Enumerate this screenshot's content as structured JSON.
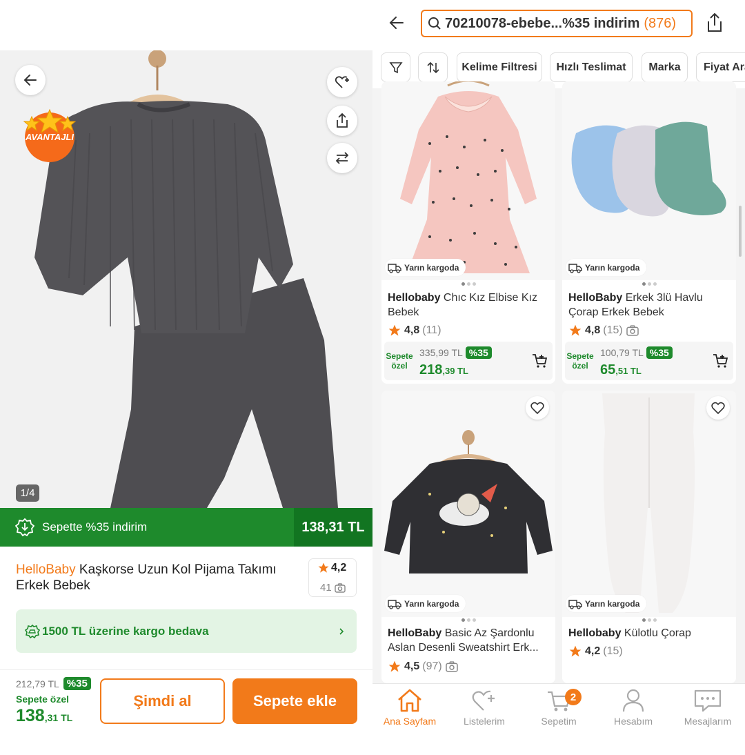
{
  "left": {
    "avantaj_label": "AVANTAJLI",
    "image_counter": "1/4",
    "promo": {
      "text": "Sepette %35 indirim",
      "price": "138,31 TL"
    },
    "product": {
      "brand": "HelloBaby",
      "name": "Kaşkorse Uzun Kol Pijama Takımı Erkek Bebek",
      "rating": "4,2",
      "review_count": "41"
    },
    "shipping_banner": "1500 TL üzerine kargo bedava",
    "bottom": {
      "old_price": "212,79 TL",
      "discount": "%35",
      "basket_label": "Sepete özel",
      "price_main": "138",
      "price_cents": ",31 TL",
      "buy_now": "Şimdi al",
      "add_to_cart": "Sepete ekle"
    }
  },
  "right": {
    "search": {
      "query": "70210078-ebebe...%35 indirim",
      "count": "(876)"
    },
    "filters": [
      "Kelime Filtresi",
      "Hızlı Teslimat",
      "Marka",
      "Fiyat Ara"
    ],
    "cards": [
      {
        "brand": "Hellobaby",
        "title": "Chıc Kız Elbise Kız Bebek",
        "rating": "4,8",
        "count": "(11)",
        "cargo": "Yarın kargoda",
        "basket_label": "Sepete özel",
        "old_price": "335,99 TL",
        "discount": "%35",
        "price_main": "218",
        "price_cents": ",39 TL"
      },
      {
        "brand": "HelloBaby",
        "title": "Erkek 3lü Havlu Çorap Erkek Bebek",
        "rating": "4,8",
        "count": "(15)",
        "cargo": "Yarın kargoda",
        "basket_label": "Sepete özel",
        "old_price": "100,79 TL",
        "discount": "%35",
        "price_main": "65",
        "price_cents": ",51 TL"
      },
      {
        "brand": "HelloBaby",
        "title": "Basic Az Şardonlu Aslan Desenli Sweatshirt Erk...",
        "rating": "4,5",
        "count": "(97)",
        "cargo": "Yarın kargoda"
      },
      {
        "brand": "Hellobaby",
        "title": "Külotlu Çorap",
        "rating": "4,2",
        "count": "(15)",
        "cargo": "Yarın kargoda"
      }
    ],
    "tabs": [
      {
        "label": "Ana Sayfam",
        "icon": "home-icon"
      },
      {
        "label": "Listelerim",
        "icon": "heart-list-icon"
      },
      {
        "label": "Sepetim",
        "icon": "cart-icon",
        "badge": "2"
      },
      {
        "label": "Hesabım",
        "icon": "user-icon"
      },
      {
        "label": "Mesajlarım",
        "icon": "chat-icon"
      }
    ]
  },
  "colors": {
    "accent": "#f27a1a",
    "green": "#1e8a2c",
    "dark_green": "#127521",
    "light_green": "#e3f4e4"
  }
}
